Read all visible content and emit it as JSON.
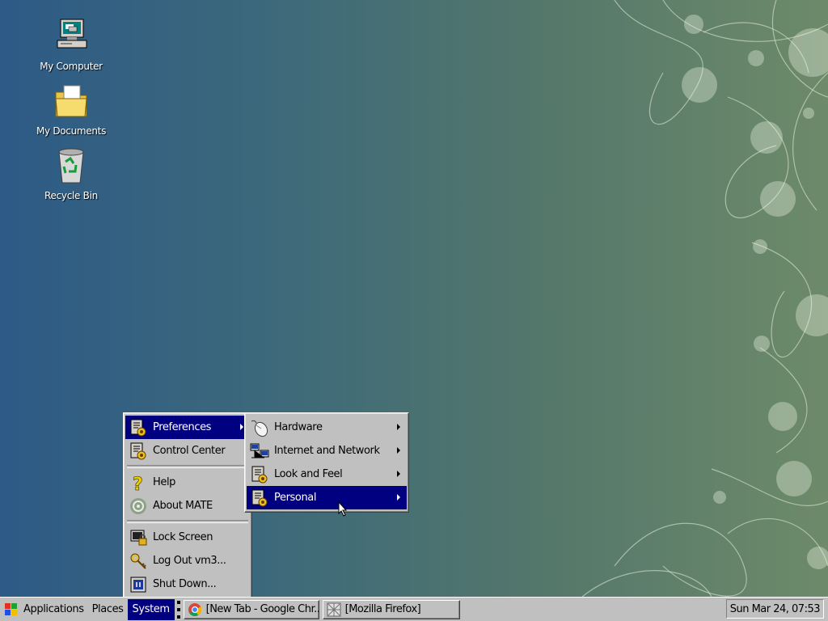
{
  "desktop": {
    "icons": [
      {
        "label": "My Computer",
        "icon": "computer-icon"
      },
      {
        "label": "My Documents",
        "icon": "folder-icon"
      },
      {
        "label": "Recycle Bin",
        "icon": "recycle-bin-icon"
      }
    ]
  },
  "system_menu": {
    "items": [
      {
        "label": "Preferences",
        "icon": "preferences-icon",
        "has_submenu": true,
        "selected": true
      },
      {
        "label": "Control Center",
        "icon": "control-center-icon"
      },
      {
        "label": "Help",
        "icon": "help-icon"
      },
      {
        "label": "About MATE",
        "icon": "mate-icon"
      },
      {
        "label": "Lock Screen",
        "icon": "lock-icon"
      },
      {
        "label": "Log Out vm3...",
        "icon": "logout-icon"
      },
      {
        "label": "Shut Down...",
        "icon": "shutdown-icon"
      }
    ]
  },
  "preferences_menu": {
    "items": [
      {
        "label": "Hardware",
        "icon": "mouse-icon",
        "has_submenu": true
      },
      {
        "label": "Internet and Network",
        "icon": "network-icon",
        "has_submenu": true
      },
      {
        "label": "Look and Feel",
        "icon": "appearance-icon",
        "has_submenu": true
      },
      {
        "label": "Personal",
        "icon": "personal-icon",
        "has_submenu": true,
        "selected": true
      }
    ]
  },
  "taskbar": {
    "menus": [
      {
        "label": "Applications",
        "icon": "windows-logo-icon"
      },
      {
        "label": "Places"
      },
      {
        "label": "System",
        "active": true
      }
    ],
    "tasks": [
      {
        "label": "[New Tab - Google Chr...",
        "icon": "chrome-icon"
      },
      {
        "label": "[Mozilla Firefox]",
        "icon": "firefox-icon"
      }
    ],
    "clock": "Sun Mar 24, 07:53"
  },
  "colors": {
    "selection": "#000080",
    "chrome_gray": "#c0c0c0",
    "desktop_left": "#2d5a86",
    "desktop_right": "#6d8a6a"
  }
}
